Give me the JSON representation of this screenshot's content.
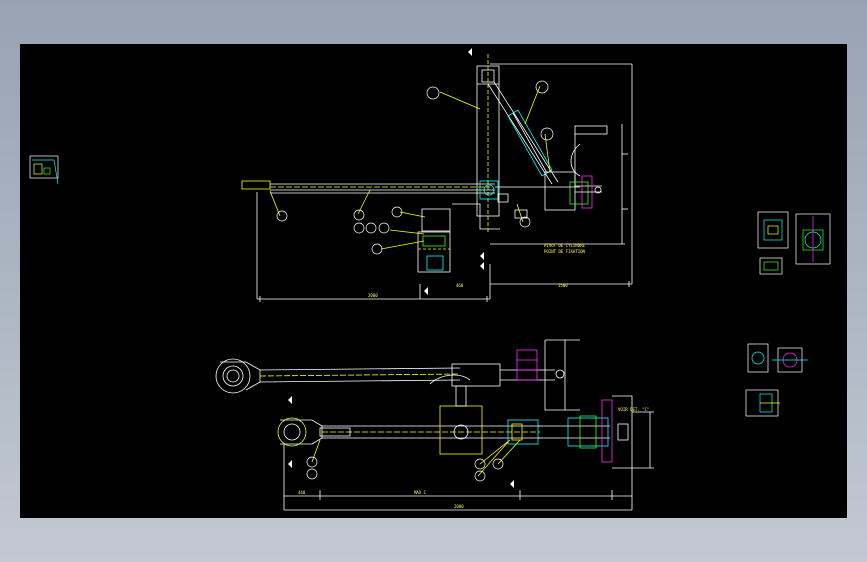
{
  "viewer": {
    "background_color": "#000000",
    "frame_color": "#a9b3c1"
  },
  "colors": {
    "yellow": "#ffff00",
    "white": "#ffffff",
    "cyan": "#00ffff",
    "magenta": "#ff2bff",
    "green": "#39ff14"
  },
  "top_view": {
    "note_label": "PIVOT DE CYLINDRE",
    "note_sub": "POINT DE FIXATION",
    "dim_bottom_left": "2000",
    "dim_bottom_mid": "460",
    "dim_bottom_right": "1500"
  },
  "bottom_view": {
    "dim_bottom_a": "440",
    "dim_bottom_b": "MAX C",
    "dim_total": "2000",
    "note_label": "VOIR DET. \"C\""
  }
}
